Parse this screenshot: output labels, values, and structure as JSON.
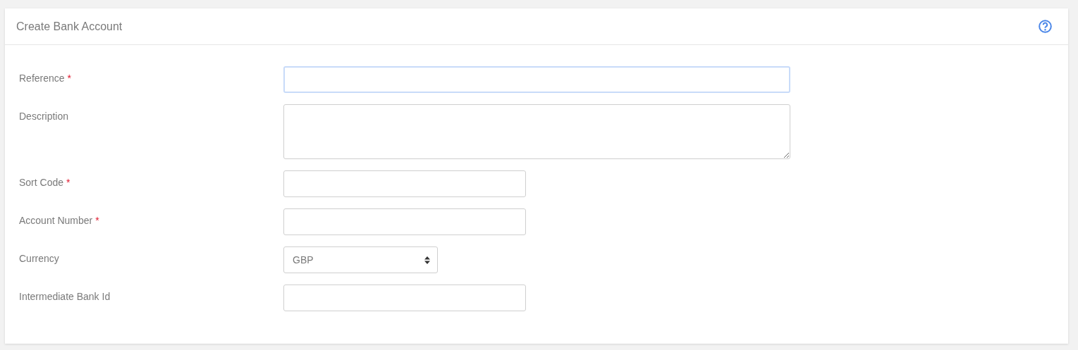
{
  "panel": {
    "title": "Create Bank Account"
  },
  "fields": [
    {
      "label": "Reference",
      "marker": "*",
      "kind": "wide-text",
      "focused": true
    },
    {
      "label": "Description",
      "kind": "textarea",
      "focused": false
    },
    {
      "label": "Sort Code",
      "marker": "*",
      "kind": "text",
      "focused": false
    },
    {
      "label": "Account Number",
      "marker": "*",
      "kind": "text",
      "focused": false
    },
    {
      "label": "Currency",
      "kind": "select",
      "value": "GBP",
      "focused": false
    },
    {
      "label": "Intermediate Bank Id",
      "kind": "text",
      "focused": false
    }
  ]
}
